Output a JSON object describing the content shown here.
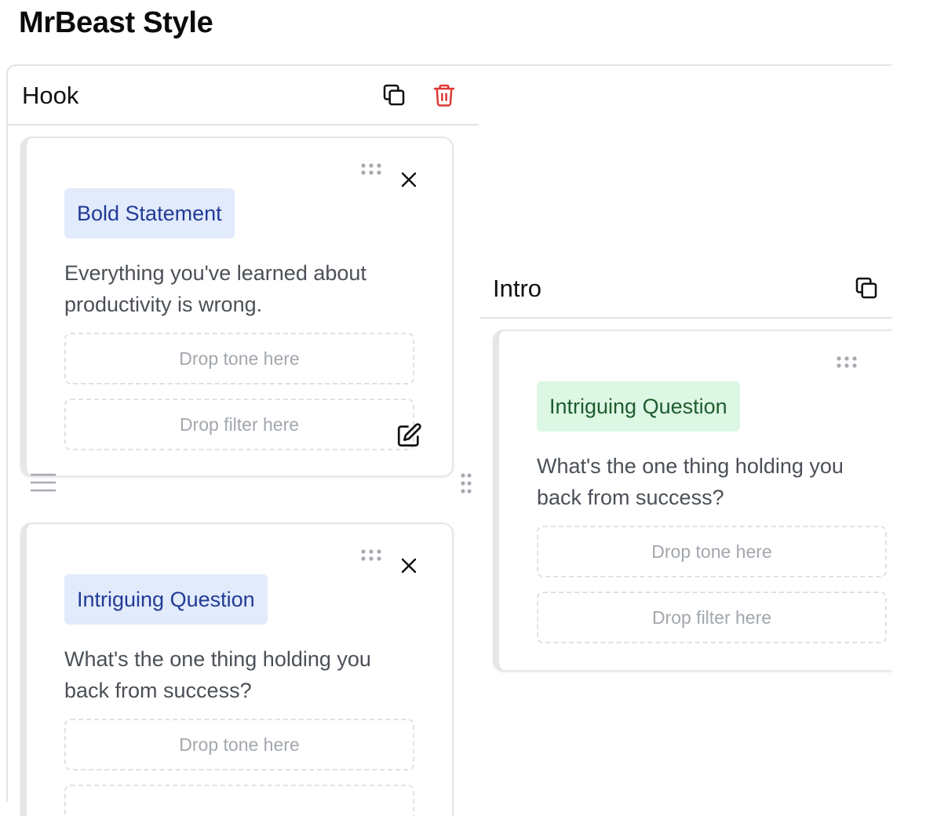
{
  "page": {
    "title": "MrBeast Style"
  },
  "sections": [
    {
      "title": "Hook",
      "icons": [
        "copy-icon",
        "trash-icon"
      ],
      "cards": [
        {
          "badge": "Bold Statement",
          "text_lines": [
            "Everything you've learned about",
            "productivity is wrong."
          ],
          "tone_placeholder": "Drop tone here",
          "filter_placeholder": "Drop filter here"
        },
        {
          "badge": "Intriguing Question",
          "text_lines": [
            "What's the one thing holding you",
            "back from success?"
          ],
          "tone_placeholder": "Drop tone here"
        }
      ]
    },
    {
      "title": "Intro",
      "icons": [
        "copy-icon"
      ],
      "cards": [
        {
          "badge": "Intriguing Question",
          "text_lines": [
            "What's the one thing holding you",
            "back from success?"
          ],
          "tone_placeholder": "Drop tone here",
          "filter_placeholder": "Drop filter here"
        }
      ]
    }
  ],
  "colors": {
    "accent_blue_bg": "#e1ebfc",
    "accent_blue_text": "#233a96",
    "accent_green_bg": "#dcf7e3",
    "accent_green_text": "#1f5c30",
    "danger": "#dc3b35"
  }
}
